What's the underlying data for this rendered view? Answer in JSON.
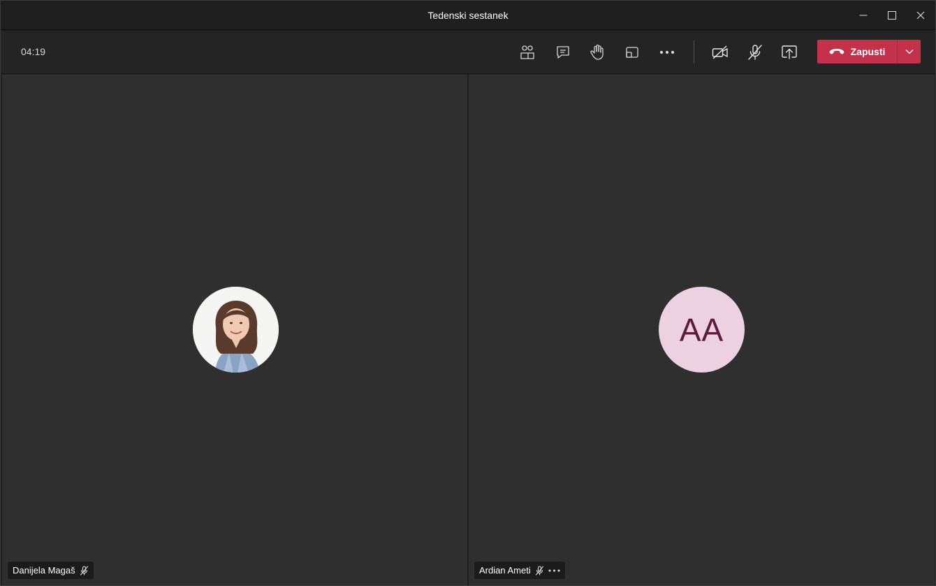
{
  "window": {
    "title": "Tedenski sestanek",
    "controls": {
      "minimize_icon": "minimize-icon",
      "maximize_icon": "maximize-icon",
      "close_icon": "close-icon"
    }
  },
  "toolbar": {
    "timer": "04:19",
    "buttons": [
      {
        "name": "participants",
        "icon": "people-icon"
      },
      {
        "name": "chat",
        "icon": "chat-icon"
      },
      {
        "name": "raise-hand",
        "icon": "hand-icon"
      },
      {
        "name": "breakout-rooms",
        "icon": "rooms-icon"
      },
      {
        "name": "more-actions",
        "icon": "more-icon"
      },
      {
        "name": "camera",
        "icon": "camera-off-icon"
      },
      {
        "name": "microphone",
        "icon": "mic-off-icon"
      },
      {
        "name": "share",
        "icon": "share-icon"
      }
    ],
    "leave": {
      "label": "Zapusti",
      "icon": "hang-up-icon",
      "dropdown_icon": "chevron-down-icon",
      "color": "#c4314b"
    }
  },
  "participants": [
    {
      "name": "Danijela Magaš",
      "avatar": "photo",
      "muted": true
    },
    {
      "name": "Ardian Ameti",
      "avatar": "initials",
      "initials": "AA",
      "muted": true,
      "avatar_color": "#ecd1e1",
      "initials_color": "#5c1d3c"
    }
  ]
}
